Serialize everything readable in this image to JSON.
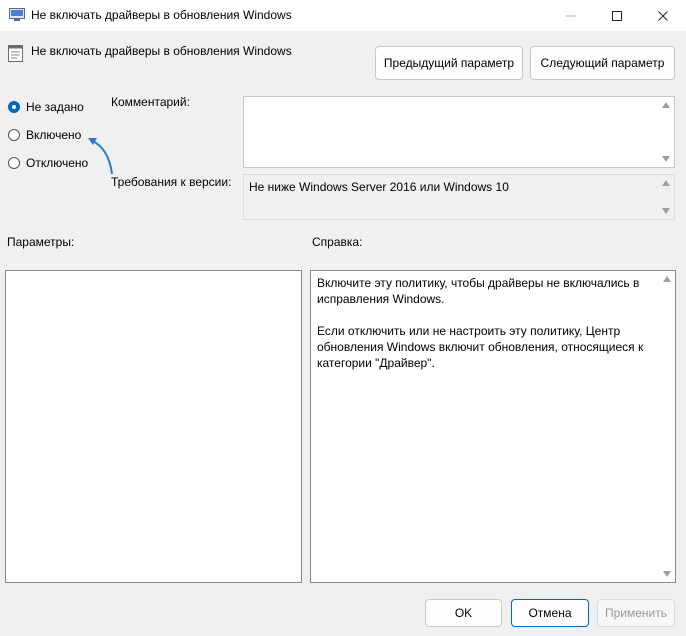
{
  "window": {
    "title": "Не включать драйверы в обновления Windows"
  },
  "header": {
    "title": "Не включать драйверы в обновления Windows",
    "prev_label": "Предыдущий параметр",
    "next_label": "Следующий параметр"
  },
  "state": {
    "options": [
      {
        "label": "Не задано",
        "checked": true
      },
      {
        "label": "Включено",
        "checked": false
      },
      {
        "label": "Отключено",
        "checked": false
      }
    ]
  },
  "comment": {
    "label": "Комментарий:",
    "value": ""
  },
  "requirements": {
    "label": "Требования к версии:",
    "value": "Не ниже Windows Server 2016 или Windows 10"
  },
  "options_panel": {
    "label": "Параметры:"
  },
  "help_panel": {
    "label": "Справка:",
    "text": "Включите эту политику, чтобы драйверы не включались в исправления Windows.\n\nЕсли отключить или не настроить эту политику, Центр обновления Windows включит обновления, относящиеся к категории \"Драйвер\"."
  },
  "footer": {
    "ok_label": "OK",
    "cancel_label": "Отмена",
    "apply_label": "Применить"
  },
  "colors": {
    "accent": "#0067c0",
    "annotation_arrow": "#2a7bd0"
  },
  "icons": [
    "policy-icon",
    "minimize-icon",
    "maximize-icon",
    "close-icon",
    "settings-page-icon"
  ]
}
